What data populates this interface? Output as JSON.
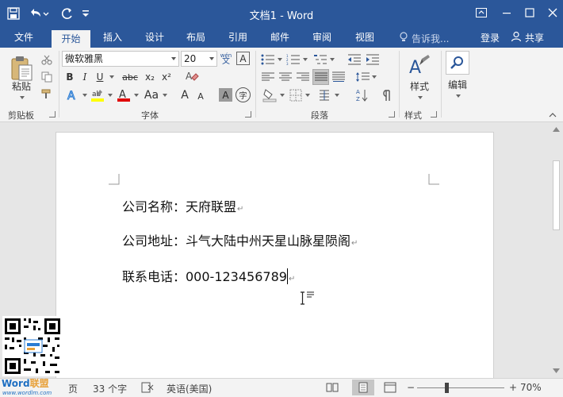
{
  "window": {
    "title": "文档1 - Word"
  },
  "tabs": [
    {
      "label": "文件"
    },
    {
      "label": "开始"
    },
    {
      "label": "插入"
    },
    {
      "label": "设计"
    },
    {
      "label": "布局"
    },
    {
      "label": "引用"
    },
    {
      "label": "邮件"
    },
    {
      "label": "审阅"
    },
    {
      "label": "视图"
    }
  ],
  "tell_me": "告诉我...",
  "login": "登录",
  "share": "共享",
  "clipboard": {
    "paste_label": "粘贴",
    "group_label": "剪贴板"
  },
  "font": {
    "name": "微软雅黑",
    "size": "20",
    "group_label": "字体",
    "wen_glyph": "A",
    "bold": "B",
    "italic": "I",
    "underline": "U",
    "strike": "abc",
    "sub": "x₂",
    "sup": "x²",
    "font_color_glyph": "A",
    "grow": "A",
    "shrink": "A",
    "char_shade": "A",
    "enclose": "字",
    "phonetic": "文"
  },
  "paragraph": {
    "group_label": "段落"
  },
  "styles": {
    "label": "样式",
    "group_label": "样式"
  },
  "editing": {
    "label": "编辑"
  },
  "document": {
    "lines": [
      "公司名称：天府联盟",
      "公司地址：斗气大陆中州天星山脉星陨阁",
      "联系电话：000-123456789"
    ]
  },
  "status": {
    "page_suffix": "页",
    "word_count": "33 个字",
    "language": "英语(美国)",
    "zoom": "70%"
  },
  "watermark": {
    "brand_word": "Word",
    "brand_cn": "联盟",
    "url": "www.wordlm.com"
  },
  "colors": {
    "title_bar": "#2b579a",
    "highlight_yellow": "#ffff00",
    "font_red": "#e00000"
  },
  "icons": [
    "save-icon",
    "undo-icon",
    "redo-icon",
    "customize-icon",
    "ribbon-display-icon",
    "minimize-icon",
    "maximize-icon",
    "close-icon",
    "search-lightbulb-icon",
    "person-icon",
    "paste-icon",
    "cut-icon",
    "copy-icon",
    "format-painter-icon",
    "find-icon",
    "ibeam-cursor-icon"
  ]
}
